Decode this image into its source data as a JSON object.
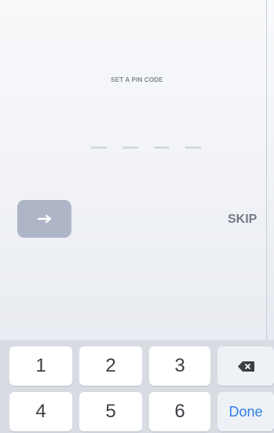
{
  "screen": {
    "title": "SET A PIN CODE",
    "pin_length": 4,
    "skip_label": "SKIP",
    "next_icon": "arrow-right-icon"
  },
  "keyboard": {
    "keys_row1": [
      "1",
      "2",
      "3"
    ],
    "keys_row2": [
      "4",
      "5",
      "6"
    ],
    "delete_icon": "backspace-icon",
    "done_label": "Done"
  },
  "colors": {
    "accent": "#2F7FE6",
    "button": "#AEB5C7",
    "text_muted": "#7F8593",
    "key_bg": "#FFFFFF",
    "keyboard_bg": "#D7DCE3"
  }
}
